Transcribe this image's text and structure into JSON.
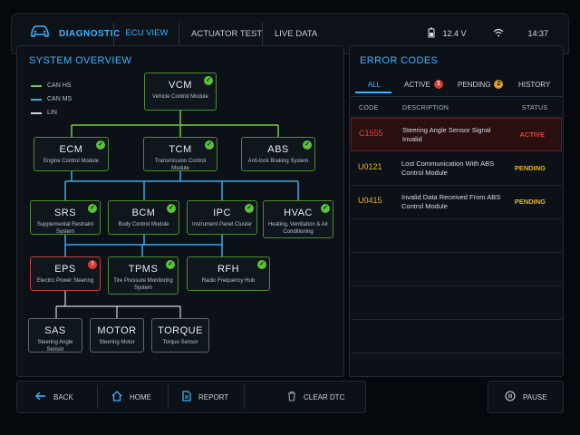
{
  "header": {
    "brand_label": "DIAGNOSTIC",
    "tabs": [
      {
        "label": "ECU VIEW",
        "active": true
      },
      {
        "label": "ACTUATOR TEST",
        "active": false
      },
      {
        "label": "LIVE DATA",
        "active": false
      }
    ],
    "voltage": "12.4 V",
    "time": "14:37"
  },
  "overview": {
    "title": "SYSTEM OVERVIEW",
    "legend": [
      {
        "label": "CAN HS",
        "color": "#7cc540"
      },
      {
        "label": "CAN MS",
        "color": "#3fa7e6"
      },
      {
        "label": "LIN",
        "color": "#cfd6dc"
      }
    ],
    "nodes": {
      "vcm": {
        "abbr": "VCM",
        "full": "Vehicle Control Module",
        "status": "ok"
      },
      "ecm": {
        "abbr": "ECM",
        "full": "Engine Control Module",
        "status": "ok"
      },
      "tcm": {
        "abbr": "TCM",
        "full": "Transmission Control Module",
        "status": "ok"
      },
      "abs": {
        "abbr": "ABS",
        "full": "Anti-lock Braking System",
        "status": "ok"
      },
      "srs": {
        "abbr": "SRS",
        "full": "Supplemental Restraint System",
        "status": "ok"
      },
      "bcm": {
        "abbr": "BCM",
        "full": "Body Control Module",
        "status": "ok"
      },
      "ipc": {
        "abbr": "IPC",
        "full": "Instrument Panel Cluster",
        "status": "ok"
      },
      "hvac": {
        "abbr": "HVAC",
        "full": "Heating, Ventilation & Air Conditioning",
        "status": "ok"
      },
      "eps": {
        "abbr": "EPS",
        "full": "Electric Power Steering",
        "status": "error"
      },
      "tpms": {
        "abbr": "TPMS",
        "full": "Tire Pressure Monitoring System",
        "status": "ok"
      },
      "rfh": {
        "abbr": "RFH",
        "full": "Radio Frequency Hub",
        "status": "ok"
      },
      "sas": {
        "abbr": "SAS",
        "full": "Steering Angle Sensor",
        "status": "none"
      },
      "motor": {
        "abbr": "MOTOR",
        "full": "Steering Motor",
        "status": "none"
      },
      "torque": {
        "abbr": "TORQUE",
        "full": "Torque Sensor",
        "status": "none"
      }
    }
  },
  "errors": {
    "title": "ERROR CODES",
    "tabs": [
      {
        "label": "ALL",
        "active": true
      },
      {
        "label": "ACTIVE",
        "badge": "1",
        "badge_color": "#d83a34"
      },
      {
        "label": "PENDING",
        "badge": "2",
        "badge_color": "#e0a020"
      },
      {
        "label": "HISTORY"
      }
    ],
    "columns": {
      "code": "CODE",
      "description": "DESCRIPTION",
      "status": "STATUS"
    },
    "rows": [
      {
        "code": "C1555",
        "description": "Steering Angle Sensor Signal Invalid",
        "status": "ACTIVE",
        "color": "#e0453c"
      },
      {
        "code": "U0121",
        "description": "Lost Communication With ABS Control Module",
        "status": "PENDING",
        "color": "#e6b422"
      },
      {
        "code": "U0415",
        "description": "Invalid Data Received From ABS Control Module",
        "status": "PENDING",
        "color": "#e6b422"
      }
    ]
  },
  "footer": {
    "back": "BACK",
    "home": "HOME",
    "report": "REPORT",
    "clear_dtc": "CLEAR DTC",
    "pause": "PAUSE"
  }
}
